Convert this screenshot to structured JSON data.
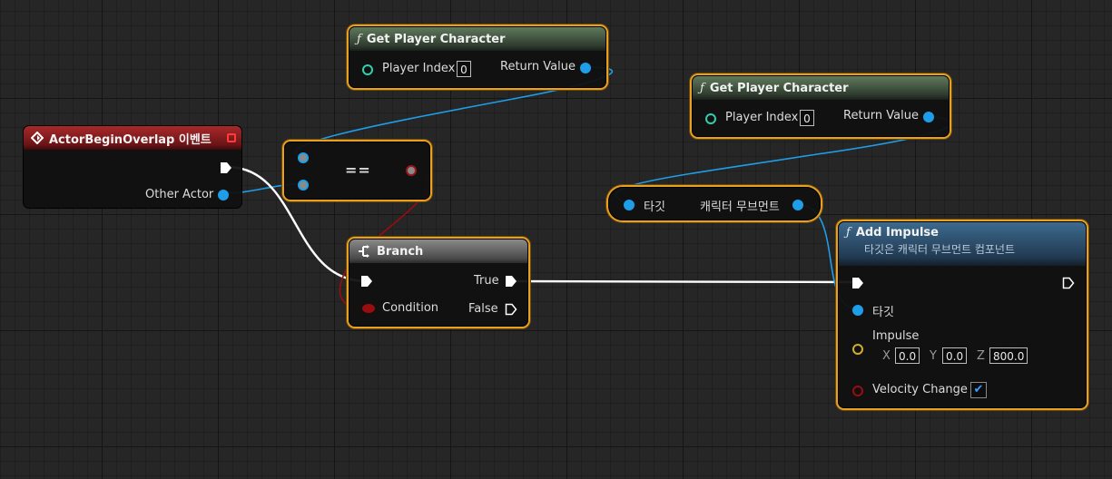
{
  "nodes": {
    "get_player_1": {
      "title": "Get Player Character",
      "input_label": "Player Index",
      "input_value": "0",
      "output_label": "Return Value"
    },
    "get_player_2": {
      "title": "Get Player Character",
      "input_label": "Player Index",
      "input_value": "0",
      "output_label": "Return Value"
    },
    "event": {
      "title": "ActorBeginOverlap 이벤트",
      "output_label": "Other Actor"
    },
    "equals": {
      "symbol": "=="
    },
    "branch": {
      "title": "Branch",
      "condition_label": "Condition",
      "true_label": "True",
      "false_label": "False"
    },
    "movement": {
      "input_label": "타깃",
      "output_label": "캐릭터 무브먼트"
    },
    "add_impulse": {
      "title": "Add Impulse",
      "subtitle": "타깃은 캐릭터 무브먼트 컴포넌트",
      "target_label": "타깃",
      "impulse_label": "Impulse",
      "x_label": "X",
      "x_value": "0.0",
      "y_label": "Y",
      "y_value": "0.0",
      "z_label": "Z",
      "z_value": "800.0",
      "velocity_label": "Velocity Change",
      "velocity_checked": "✔"
    }
  },
  "icons": {
    "function": "ƒ",
    "event": "event-diamond-icon",
    "branch": "branch-icon"
  },
  "colors": {
    "selection": "#e8a020",
    "object_pin": "#1e9ee8",
    "exec_wire": "#ffffff",
    "bool_pin": "#9a0c10"
  }
}
